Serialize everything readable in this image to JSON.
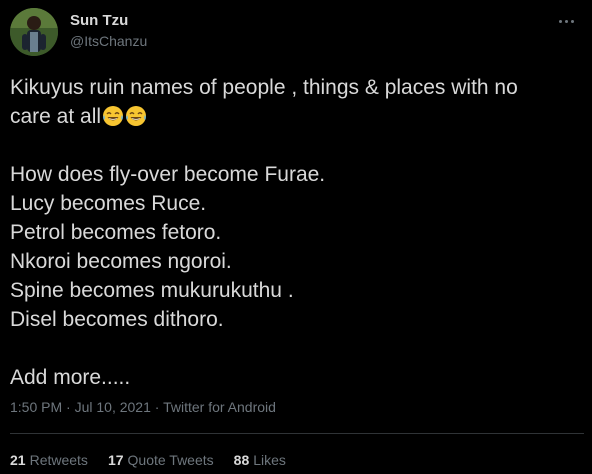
{
  "author": {
    "name": "Sun Tzu",
    "handle": "@ItsChanzu",
    "avatar_icon": "profile-photo-person-green-background"
  },
  "more_icon": "more-options-icon",
  "tweet": {
    "line1": "Kikuyus  ruin names of people , things & places with no",
    "line2": "care at all",
    "emoji": "face-with-tears-of-joy",
    "lines": [
      "How does fly-over become Furae.",
      "Lucy becomes Ruce.",
      "Petrol becomes fetoro.",
      "Nkoroi becomes ngoroi.",
      "Spine becomes mukurukuthu .",
      "Disel becomes dithoro."
    ],
    "closing": "Add more....."
  },
  "meta": {
    "time": "1:50 PM",
    "date": "Jul 10, 2021",
    "separator": "·",
    "source": "Twitter for Android"
  },
  "stats": {
    "retweets_count": "21",
    "retweets_label": "Retweets",
    "quotes_count": "17",
    "quotes_label": "Quote Tweets",
    "likes_count": "88",
    "likes_label": "Likes"
  },
  "colors": {
    "background": "#000000",
    "text": "#d9d9d9",
    "secondary": "#6e767d",
    "divider": "#2f3336"
  }
}
